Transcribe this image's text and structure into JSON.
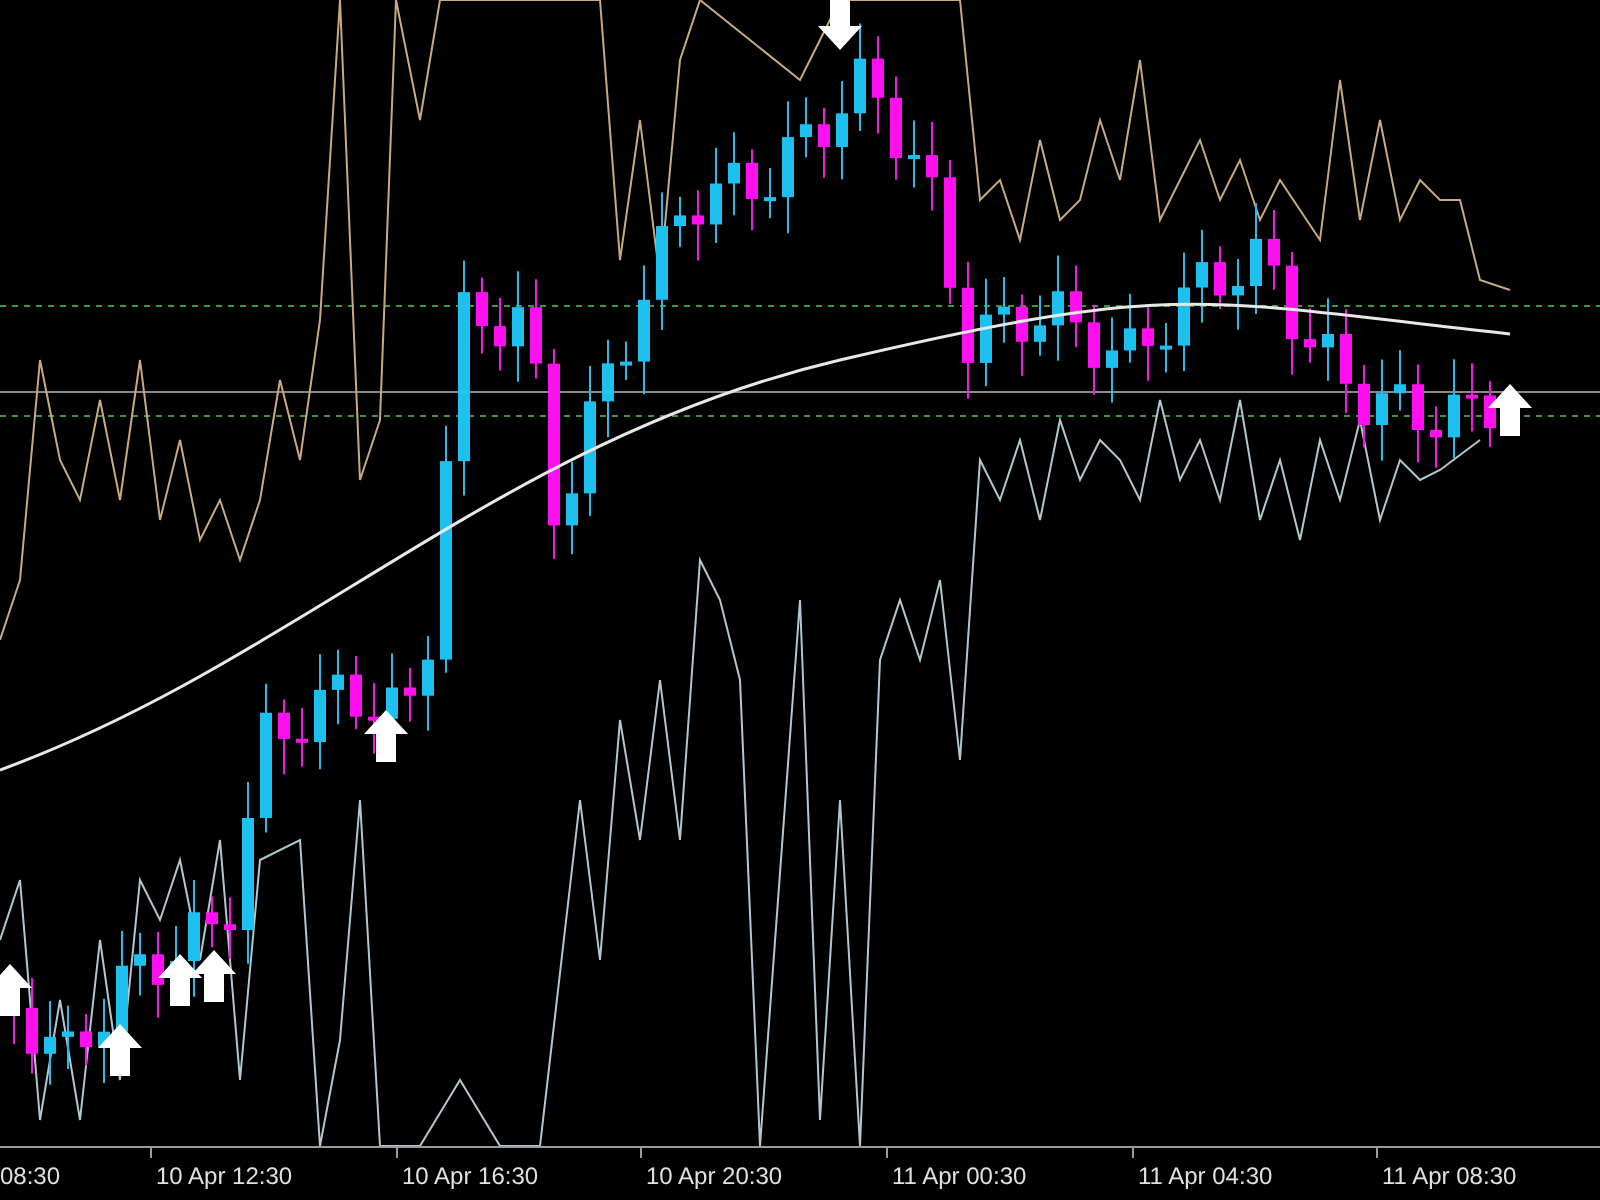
{
  "x_axis": {
    "labels": [
      "08:30",
      "10 Apr 12:30",
      "10 Apr 16:30",
      "10 Apr 20:30",
      "11 Apr 00:30",
      "11 Apr 04:30",
      "11 Apr 08:30"
    ]
  }
}
